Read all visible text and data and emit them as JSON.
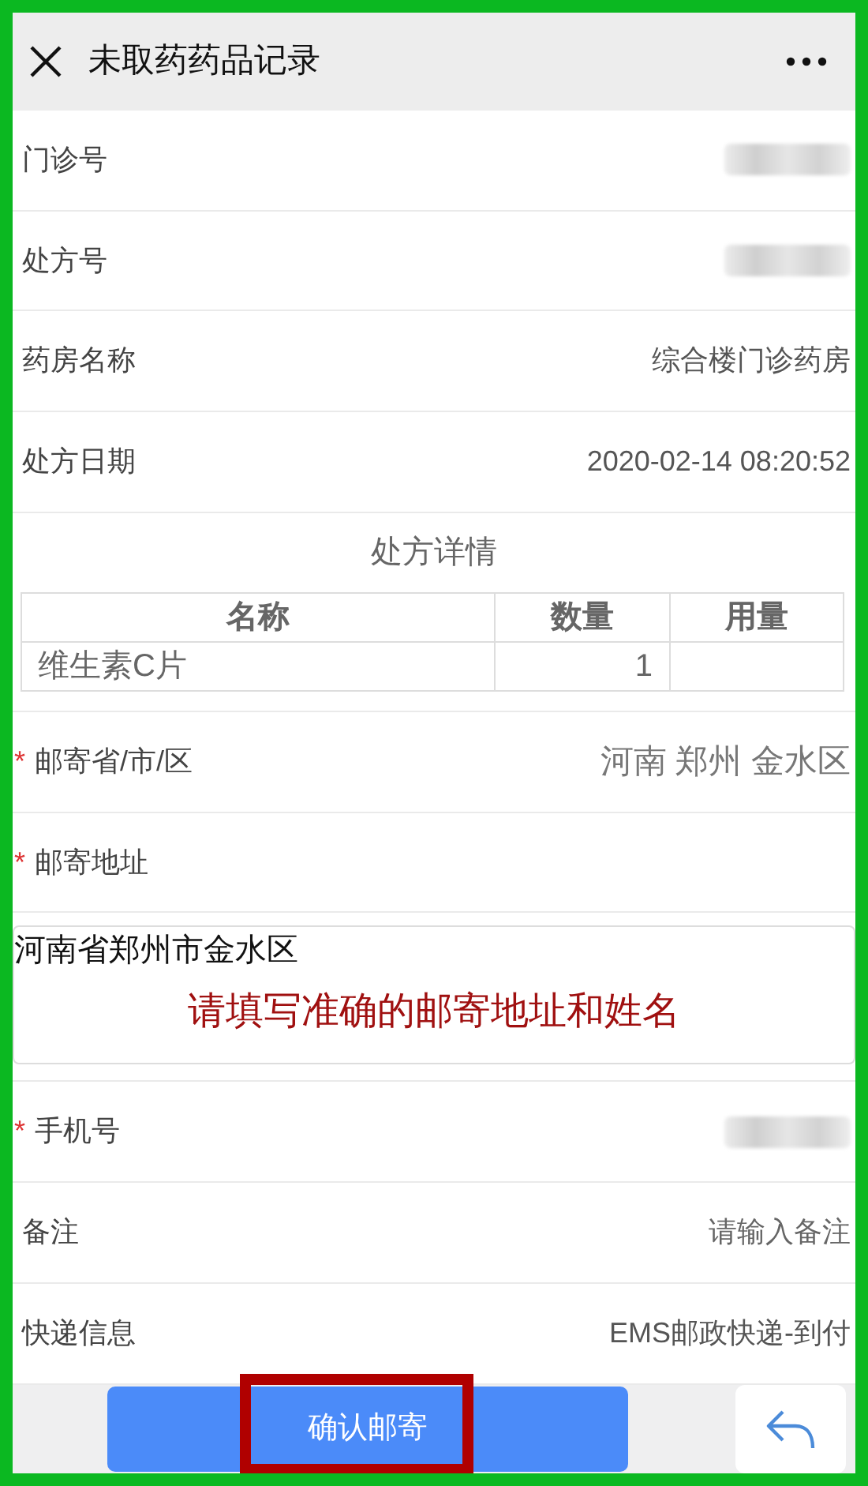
{
  "header": {
    "title": "未取药药品记录"
  },
  "fields_top": [
    {
      "label": "门诊号",
      "kind": "masked"
    },
    {
      "label": "处方号",
      "kind": "masked"
    },
    {
      "label": "药房名称",
      "kind": "text",
      "value": "综合楼门诊药房"
    },
    {
      "label": "处方日期",
      "kind": "text",
      "value": "2020-02-14 08:20:52"
    }
  ],
  "detail": {
    "title": "处方详情",
    "columns": [
      "名称",
      "数量",
      "用量"
    ],
    "rows": [
      [
        "维生素C片",
        "1",
        ""
      ]
    ]
  },
  "fields_mid": [
    {
      "label": "邮寄省/市/区",
      "required_mark": "*",
      "kind": "picker",
      "value": "河南 郑州 金水区"
    },
    {
      "label": "邮寄地址",
      "required_mark": "*",
      "kind": "label"
    }
  ],
  "address": {
    "value": "河南省郑州市金水区",
    "annotation": "请填写准确的邮寄地址和姓名"
  },
  "fields_bottom": [
    {
      "label": "手机号",
      "required_mark": "*",
      "kind": "masked"
    },
    {
      "label": "备注",
      "kind": "input",
      "placeholder": "请输入备注"
    },
    {
      "label": "快递信息",
      "kind": "text",
      "value": "EMS邮政快递-到付"
    }
  ],
  "footer": {
    "confirm": "确认邮寄",
    "highlighted": true
  }
}
